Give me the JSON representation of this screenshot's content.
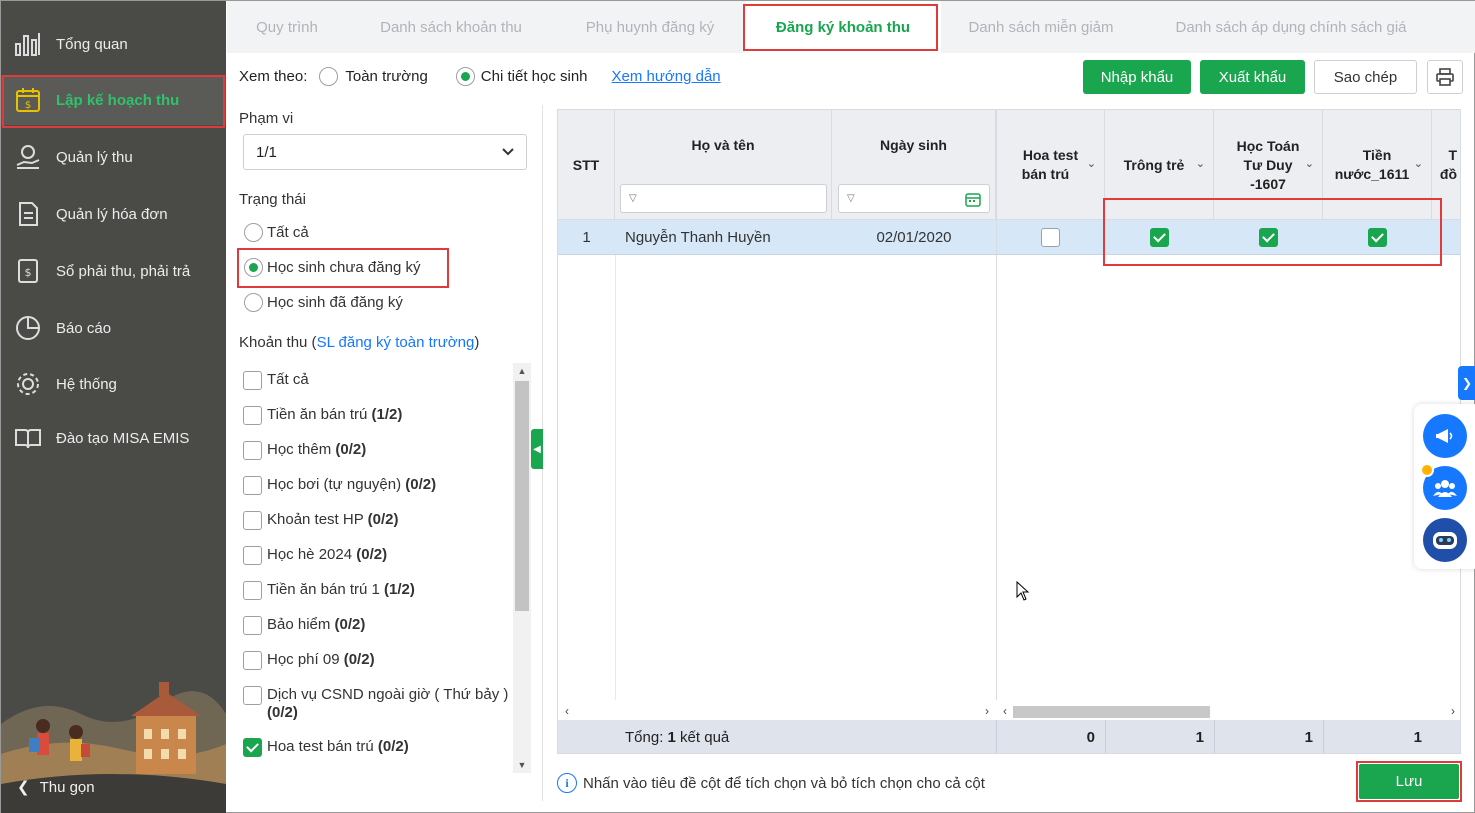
{
  "sidebar": {
    "items": [
      {
        "label": "Tổng quan",
        "icon": "chart-bars-icon"
      },
      {
        "label": "Lập kế hoạch thu",
        "icon": "calendar-dollar-icon",
        "active": true
      },
      {
        "label": "Quản lý thu",
        "icon": "money-hand-icon"
      },
      {
        "label": "Quản lý hóa đơn",
        "icon": "invoice-icon"
      },
      {
        "label": "Sổ phải thu, phải trả",
        "icon": "ledger-icon"
      },
      {
        "label": "Báo cáo",
        "icon": "pie-chart-icon"
      },
      {
        "label": "Hệ thống",
        "icon": "gear-icon"
      },
      {
        "label": "Đào tạo MISA EMIS",
        "icon": "book-icon"
      }
    ],
    "collapse_label": "Thu gọn"
  },
  "tabs": [
    {
      "label": "Quy trình"
    },
    {
      "label": "Danh sách khoản thu"
    },
    {
      "label": "Phụ huynh đăng ký"
    },
    {
      "label": "Đăng ký khoản thu",
      "active": true
    },
    {
      "label": "Danh sách miễn giảm"
    },
    {
      "label": "Danh sách áp dụng chính sách giá"
    }
  ],
  "view": {
    "label": "Xem theo:",
    "option_all": "Toàn trường",
    "option_detail": "Chi tiết học sinh",
    "selected": "Chi tiết học sinh",
    "guide_link": "Xem hướng dẫn"
  },
  "scope": {
    "label": "Phạm vi",
    "value": "1/1"
  },
  "status": {
    "label": "Trạng thái",
    "options": [
      "Tất cả",
      "Học sinh chưa đăng ký",
      "Học sinh đã đăng ký"
    ],
    "selected": "Học sinh chưa đăng ký"
  },
  "fees": {
    "label_prefix": "Khoản thu (",
    "label_link": "SL đăng ký toàn trường",
    "label_suffix": ")",
    "items": [
      {
        "name": "Tất cả",
        "count": "",
        "checked": false
      },
      {
        "name": "Tiền ăn bán trú",
        "count": "(1/2)",
        "checked": false
      },
      {
        "name": "Học thêm",
        "count": "(0/2)",
        "checked": false
      },
      {
        "name": "Học bơi (tự nguyện)",
        "count": "(0/2)",
        "checked": false
      },
      {
        "name": "Khoản test HP",
        "count": "(0/2)",
        "checked": false
      },
      {
        "name": "Học hè 2024",
        "count": "(0/2)",
        "checked": false
      },
      {
        "name": "Tiền ăn bán trú 1",
        "count": "(1/2)",
        "checked": false
      },
      {
        "name": "Bảo hiểm",
        "count": "(0/2)",
        "checked": false
      },
      {
        "name": "Học phí 09",
        "count": "(0/2)",
        "checked": false
      },
      {
        "name": "Dịch vụ CSND ngoài giờ ( Thứ bảy )",
        "count": "(0/2)",
        "checked": false
      },
      {
        "name": "Hoa test bán trú",
        "count": "(0/2)",
        "checked": true
      }
    ]
  },
  "toolbar": {
    "import": "Nhập khẩu",
    "export": "Xuất khẩu",
    "copy": "Sao chép",
    "print_icon": "printer-icon"
  },
  "grid": {
    "headers": {
      "stt": "STT",
      "name": "Họ và tên",
      "dob": "Ngày sinh",
      "fee1": [
        "Hoa test",
        "bán trú"
      ],
      "fee2": [
        "Trông trẻ"
      ],
      "fee3": [
        "Học Toán",
        "Tư Duy",
        "-1607"
      ],
      "fee4": [
        "Tiền",
        "nước_1611"
      ],
      "fee5": [
        "T",
        "đồ"
      ]
    },
    "rows": [
      {
        "stt": "1",
        "name": "Nguyễn Thanh Huyền",
        "dob": "02/01/2020",
        "fee1": false,
        "fee2": true,
        "fee3": true,
        "fee4": true
      }
    ],
    "footer": {
      "total_prefix": "Tổng: ",
      "total_count": "1",
      "total_suffix": " kết quả",
      "fee1": "0",
      "fee2": "1",
      "fee3": "1",
      "fee4": "1"
    }
  },
  "note": "Nhấn vào tiêu đề cột để tích chọn và bỏ tích chọn cho cả cột",
  "save_label": "Lưu",
  "colors": {
    "accent": "#1aa54f",
    "highlight": "#e03a3a",
    "link": "#1677ff",
    "sidebar": "#4a4a47"
  }
}
